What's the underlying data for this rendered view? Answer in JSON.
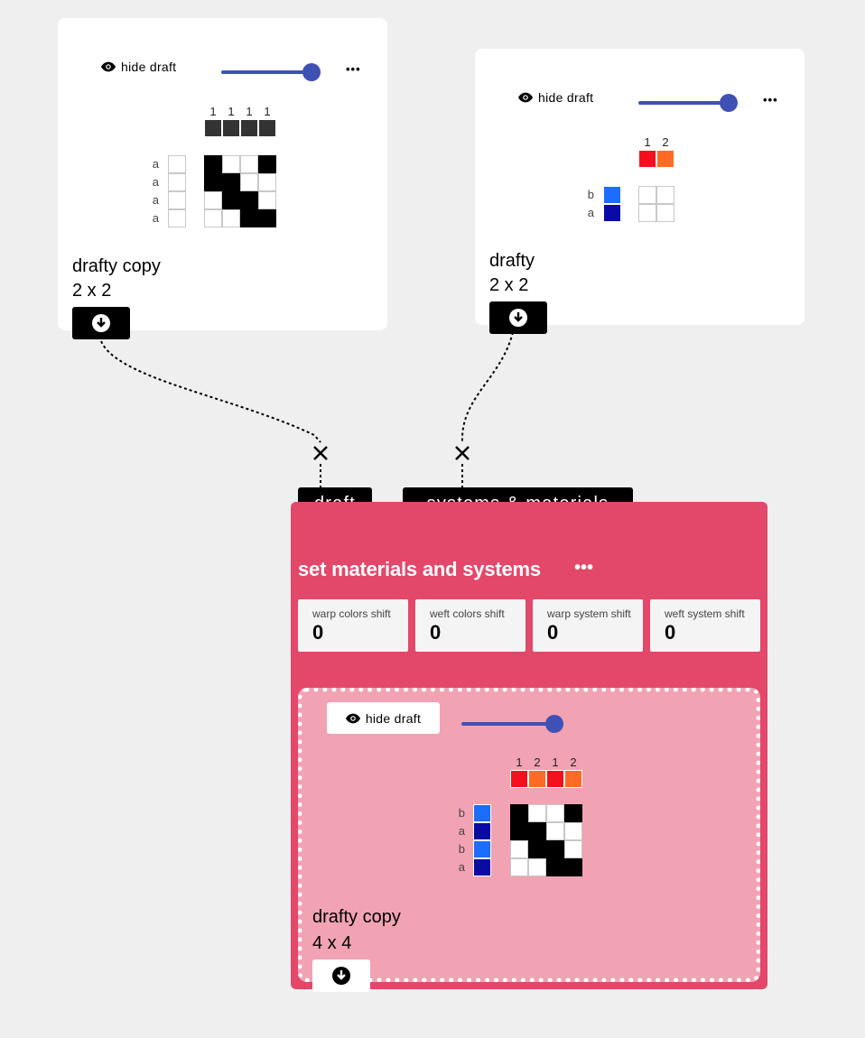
{
  "draft_a": {
    "hide_label": "hide draft",
    "more_label": "•••",
    "warp_numbers": [
      "1",
      "1",
      "1",
      "1"
    ],
    "weft_labels": [
      "a",
      "a",
      "a",
      "a"
    ],
    "name": "drafty copy",
    "size": "2 x 2",
    "pattern": [
      [
        1,
        0,
        0,
        1
      ],
      [
        1,
        1,
        0,
        0
      ],
      [
        0,
        1,
        1,
        0
      ],
      [
        0,
        0,
        1,
        1
      ]
    ]
  },
  "draft_b": {
    "hide_label": "hide draft",
    "more_label": "•••",
    "warp_numbers": [
      "1",
      "2"
    ],
    "warp_colors": [
      "#f5101e",
      "#ff6a24"
    ],
    "weft_labels": [
      "b",
      "a"
    ],
    "weft_colors": [
      "#1c6dff",
      "#0a0aa5"
    ],
    "name": "drafty",
    "size": "2 x 2",
    "pattern": [
      [
        0,
        0
      ],
      [
        0,
        0
      ]
    ]
  },
  "operation": {
    "inputs": {
      "draft": "draft",
      "systems": "systems & materials"
    },
    "title": "set materials and systems",
    "more_label": "•••",
    "params": [
      {
        "label": "warp colors shift",
        "value": "0"
      },
      {
        "label": "weft colors shift",
        "value": "0"
      },
      {
        "label": "warp system shift",
        "value": "0"
      },
      {
        "label": "weft system shift",
        "value": "0"
      }
    ],
    "output": {
      "hide_label": "hide draft",
      "warp_numbers": [
        "1",
        "2",
        "1",
        "2"
      ],
      "warp_colors": [
        "#f5101e",
        "#ff6a24",
        "#f5101e",
        "#ff6a24"
      ],
      "weft_labels": [
        "b",
        "a",
        "b",
        "a"
      ],
      "weft_colors": [
        "#1c6dff",
        "#0a0aa5",
        "#1c6dff",
        "#0a0aa5"
      ],
      "name": "drafty copy",
      "size": "4 x 4",
      "pattern": [
        [
          1,
          0,
          0,
          1
        ],
        [
          1,
          1,
          0,
          0
        ],
        [
          0,
          1,
          1,
          0
        ],
        [
          0,
          0,
          1,
          1
        ]
      ]
    }
  },
  "icons": {
    "eye": "eye-icon",
    "download": "download-icon",
    "disconnect": "close-icon"
  },
  "colors": {
    "accent": "#3f51b5",
    "operation": "#e3476a",
    "operation_inner": "#f1a2b3",
    "warp_header": "#333333"
  }
}
